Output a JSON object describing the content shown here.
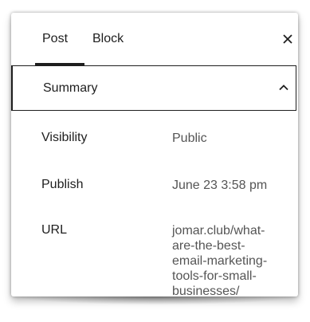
{
  "tabs": [
    {
      "label": "Post",
      "active": true
    },
    {
      "label": "Block",
      "active": false
    }
  ],
  "close_icon": "close-icon",
  "summary": {
    "title": "Summary",
    "expanded": true,
    "toggle_icon": "chevron-up-icon"
  },
  "rows": [
    {
      "label": "Visibility",
      "value": "Public"
    },
    {
      "label": "Publish",
      "value": "June 23 3:58 pm"
    },
    {
      "label": "URL",
      "value": "jomar.club/what-\nare-the-best-\nemail-marketing-\ntools-for-small-\nbusinesses/"
    }
  ],
  "colors": {
    "text": "#1e1e1e",
    "muted": "#555555",
    "border": "#1e1e1e"
  }
}
